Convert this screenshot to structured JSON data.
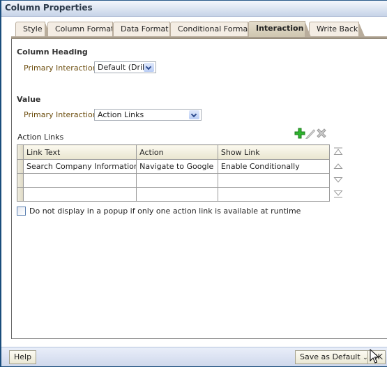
{
  "window": {
    "title": "Column Properties"
  },
  "tabs": [
    {
      "label": "Style",
      "active": false
    },
    {
      "label": "Column Format",
      "active": false
    },
    {
      "label": "Data Format",
      "active": false
    },
    {
      "label": "Conditional Format",
      "active": false
    },
    {
      "label": "Interaction",
      "active": true
    },
    {
      "label": "Write Back",
      "active": false
    }
  ],
  "column_heading": {
    "heading": "Column Heading",
    "primary_interaction_label": "Primary Interaction",
    "primary_interaction_value": "Default (Drill)"
  },
  "value": {
    "heading": "Value",
    "primary_interaction_label": "Primary Interaction",
    "primary_interaction_value": "Action Links"
  },
  "action_links": {
    "label": "Action Links",
    "toolbar": {
      "add": "add-icon",
      "edit": "edit-icon",
      "delete": "delete-icon"
    },
    "columns": [
      "Link Text",
      "Action",
      "Show Link"
    ],
    "rows": [
      [
        "Search Company Information",
        "Navigate to Google",
        "Enable Conditionally"
      ],
      [
        "",
        "",
        ""
      ],
      [
        "",
        "",
        ""
      ]
    ],
    "move_buttons": [
      "move-top-icon",
      "move-up-icon",
      "move-down-icon",
      "move-bottom-icon"
    ]
  },
  "popup_option": {
    "label": "Do not display in a popup if only one action link is available at runtime",
    "checked": false
  },
  "footer": {
    "help": "Help",
    "save_default": "Save as Default",
    "ok": "OK"
  }
}
